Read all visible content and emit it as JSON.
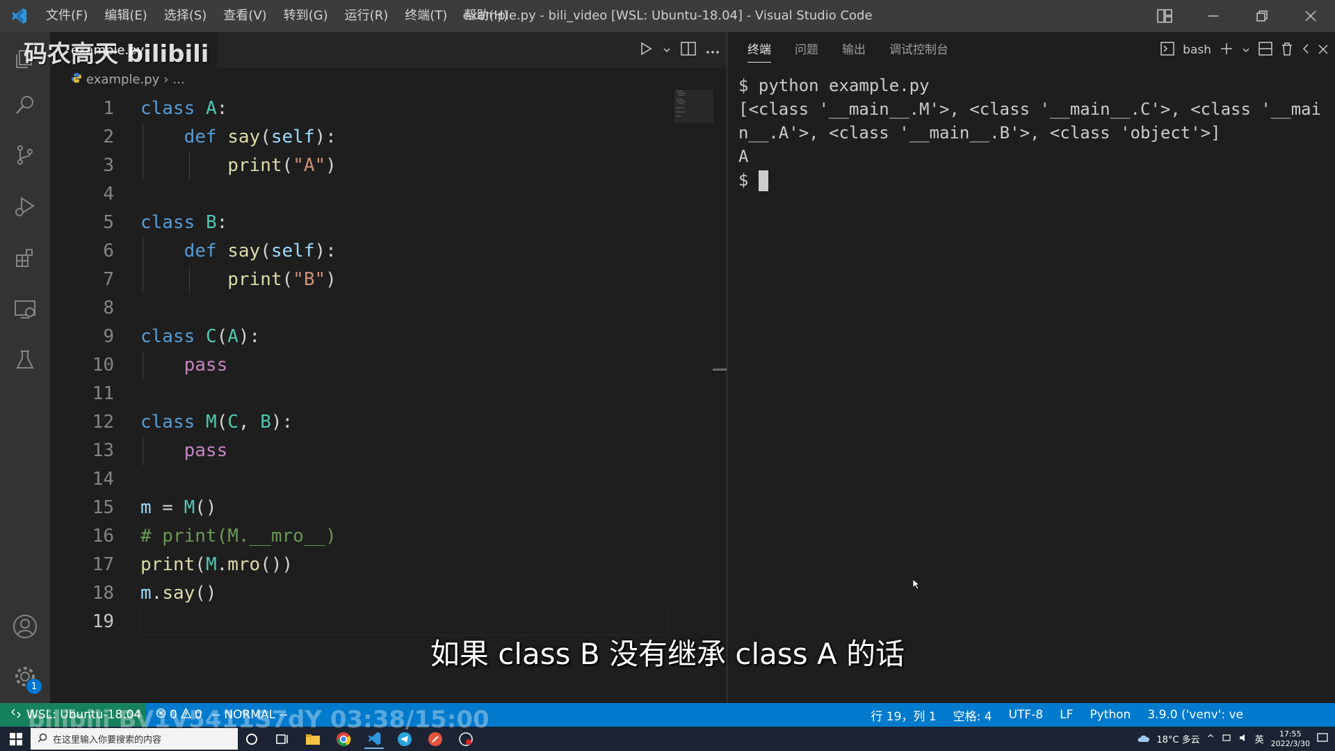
{
  "window": {
    "title": "example.py - bili_video [WSL: Ubuntu-18.04] - Visual Studio Code",
    "menu": [
      "文件(F)",
      "编辑(E)",
      "选择(S)",
      "查看(V)",
      "转到(G)",
      "运行(R)",
      "终端(T)",
      "帮助(H)"
    ]
  },
  "activity_bar": {
    "items": [
      "explorer-icon",
      "search-icon",
      "source-control-icon",
      "run-debug-icon",
      "extensions-icon",
      "remote-explorer-icon",
      "testing-icon"
    ],
    "bottom": [
      "account-icon",
      "settings-gear-icon"
    ],
    "settings_badge": "1"
  },
  "editor": {
    "tab_label": "example.py",
    "breadcrumb": [
      "example.py",
      "..."
    ],
    "lines": [
      {
        "n": "1"
      },
      {
        "n": "2"
      },
      {
        "n": "3"
      },
      {
        "n": "4"
      },
      {
        "n": "5"
      },
      {
        "n": "6"
      },
      {
        "n": "7"
      },
      {
        "n": "8"
      },
      {
        "n": "9"
      },
      {
        "n": "10"
      },
      {
        "n": "11"
      },
      {
        "n": "12"
      },
      {
        "n": "13"
      },
      {
        "n": "14"
      },
      {
        "n": "15"
      },
      {
        "n": "16"
      },
      {
        "n": "17"
      },
      {
        "n": "18"
      },
      {
        "n": "19"
      }
    ],
    "tok": {
      "class": "class",
      "def": "def",
      "self": "self",
      "say": "say",
      "print": "print",
      "pass": "pass",
      "A": "A",
      "B": "B",
      "C": "C",
      "M": "M",
      "m": "m",
      "mro": "mro",
      "strA": "\"A\"",
      "strB": "\"B\"",
      "comment": "# print(M.__mro__)"
    }
  },
  "terminal": {
    "tabs": [
      "终端",
      "问题",
      "输出",
      "调试控制台"
    ],
    "active_tab": "终端",
    "shell": "bash",
    "output": [
      "$ python example.py",
      "[<class '__main__.M'>, <class '__main__.C'>, <class '__mai",
      "n__.A'>, <class '__main__.B'>, <class 'object'>]",
      "A"
    ],
    "prompt": "$ "
  },
  "status_bar": {
    "remote": "WSL: Ubuntu-18.04",
    "errors": "0",
    "warnings": "0",
    "mode": "-- NORMAL --",
    "position": "行 19，列 1",
    "spaces": "空格: 4",
    "encoding": "UTF-8",
    "eol": "LF",
    "language": "Python",
    "interpreter": "3.9.0 ('venv': ve"
  },
  "taskbar": {
    "search_placeholder": "在这里输入你要搜索的内容",
    "weather": "18°C 多云",
    "ime": "英",
    "time": "17:55",
    "date": "2022/3/30"
  },
  "overlay": {
    "subtitle": "如果 class B 没有继承 class A 的话",
    "watermark": "码农高天 bilibili",
    "watermark_bottom": "bilibili BV1V5411S7dY 03:38/15:00"
  },
  "colors": {
    "keyword": "#569cd6",
    "class_name": "#4ec9b0",
    "function": "#dcdcaa",
    "string": "#ce9178",
    "param": "#9cdcfe",
    "control": "#c586c0",
    "comment": "#6a9955",
    "status_bar": "#007acc",
    "remote": "#16825d"
  }
}
